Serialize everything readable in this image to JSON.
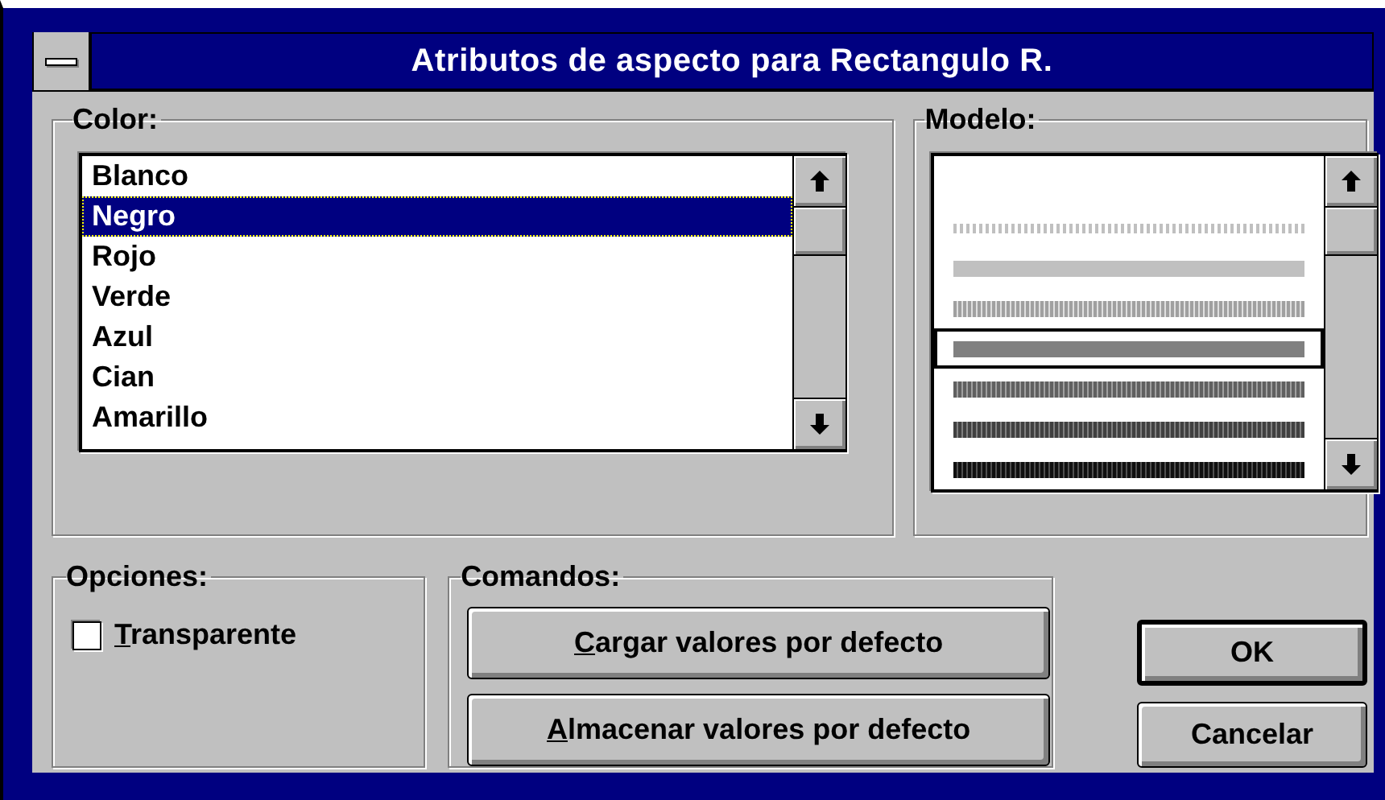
{
  "window": {
    "title": "Atributos de aspecto para Rectangulo R."
  },
  "color_group": {
    "label": "Color:",
    "items": [
      {
        "label": "Blanco",
        "selected": false
      },
      {
        "label": "Negro",
        "selected": true
      },
      {
        "label": "Rojo",
        "selected": false
      },
      {
        "label": "Verde",
        "selected": false
      },
      {
        "label": "Azul",
        "selected": false
      },
      {
        "label": "Cian",
        "selected": false
      },
      {
        "label": "Amarillo",
        "selected": false
      }
    ]
  },
  "model_group": {
    "label": "Modelo:",
    "items": [
      {
        "kind": "blank",
        "selected": false
      },
      {
        "kind": "dotted",
        "selected": false
      },
      {
        "kind": "light",
        "selected": false
      },
      {
        "kind": "hatched",
        "selected": false
      },
      {
        "kind": "gray",
        "selected": true
      },
      {
        "kind": "dense",
        "selected": false
      },
      {
        "kind": "darker",
        "selected": false
      },
      {
        "kind": "darkest",
        "selected": false
      }
    ]
  },
  "options_group": {
    "label": "Opciones:",
    "checkbox": {
      "label": "Transparente",
      "mnemonic": true,
      "checked": false
    }
  },
  "commands_group": {
    "label": "Comandos:",
    "buttons": [
      {
        "label": "Cargar valores por defecto",
        "mnemonic": true
      },
      {
        "label": "Almacenar valores por defecto",
        "mnemonic": true
      }
    ]
  },
  "buttons": [
    {
      "label": "OK",
      "default": true
    },
    {
      "label": "Cancelar",
      "default": false
    }
  ]
}
